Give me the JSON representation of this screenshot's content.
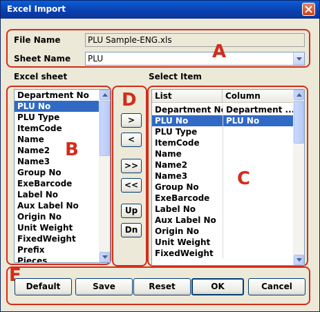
{
  "window": {
    "title": "Excel Import"
  },
  "file": {
    "file_name_label": "File Name",
    "file_name_value": "PLU Sample-ENG.xls",
    "sheet_name_label": "Sheet Name",
    "sheet_name_value": "PLU"
  },
  "excel_sheet": {
    "label": "Excel sheet",
    "items": [
      "Department No",
      "PLU No",
      "PLU Type",
      "ItemCode",
      "Name",
      "Name2",
      "Name3",
      "Group No",
      "ExeBarcode",
      "Label No",
      "Aux Label No",
      "Origin No",
      "Unit Weight",
      "FixedWeight",
      "Prefix",
      "Pieces"
    ],
    "selected_index": 1
  },
  "select_item": {
    "label": "Select Item",
    "col_list": "List",
    "col_column": "Column",
    "rows": [
      {
        "list": "Department No",
        "column": "Department ..."
      },
      {
        "list": "PLU No",
        "column": "PLU No"
      },
      {
        "list": "PLU Type",
        "column": ""
      },
      {
        "list": "ItemCode",
        "column": ""
      },
      {
        "list": "Name",
        "column": ""
      },
      {
        "list": "Name2",
        "column": ""
      },
      {
        "list": "Name3",
        "column": ""
      },
      {
        "list": "Group No",
        "column": ""
      },
      {
        "list": "ExeBarcode",
        "column": ""
      },
      {
        "list": "Label No",
        "column": ""
      },
      {
        "list": "Aux Label No",
        "column": ""
      },
      {
        "list": "Origin No",
        "column": ""
      },
      {
        "list": "Unit Weight",
        "column": ""
      },
      {
        "list": "FixedWeight",
        "column": ""
      }
    ],
    "selected_index": 1
  },
  "move_buttons": {
    "add": ">",
    "remove": "<",
    "add_all": ">>",
    "remove_all": "<<",
    "up": "Up",
    "down": "Dn"
  },
  "footer_buttons": {
    "default": "Default",
    "save": "Save",
    "reset": "Reset",
    "ok": "OK",
    "cancel": "Cancel"
  },
  "annotations": {
    "a": "A",
    "b": "B",
    "c": "C",
    "d": "D",
    "e": "E"
  },
  "colors": {
    "annotation_red": "#d42c1a",
    "selection_blue": "#316ac5",
    "title_blue": "#0b3fb0"
  }
}
